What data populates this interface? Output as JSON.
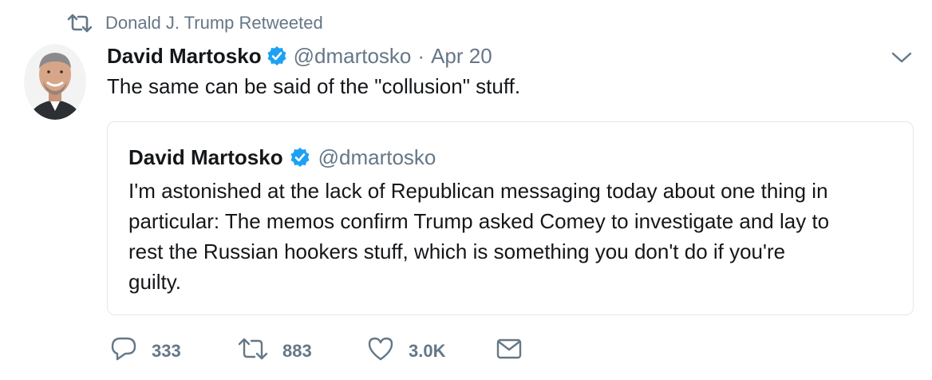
{
  "retweet": {
    "label": "Donald J. Trump Retweeted",
    "icon": "retweet-icon"
  },
  "tweet": {
    "author": "David Martosko",
    "handle": "@dmartosko",
    "separator": "·",
    "date": "Apr 20",
    "text": "The same can be said of the \"collusion\" stuff.",
    "verified_icon": "verified-badge-icon",
    "menu_icon": "chevron-down-icon"
  },
  "quoted": {
    "author": "David Martosko",
    "handle": "@dmartosko",
    "lines": [
      "I'm astonished at the lack of Republican messaging today about one thing in",
      "particular: The memos confirm Trump asked Comey to investigate and lay to",
      "rest the Russian hookers stuff, which is something you don't do if you're",
      "guilty."
    ]
  },
  "actions": {
    "replies": "333",
    "retweets": "883",
    "likes": "3.0K",
    "icons": [
      "reply-icon",
      "retweet-icon",
      "like-icon",
      "message-icon"
    ]
  },
  "colors": {
    "text": "#14171a",
    "muted": "#657786",
    "verified": "#1da1f2",
    "border": "#e1e8ed"
  }
}
